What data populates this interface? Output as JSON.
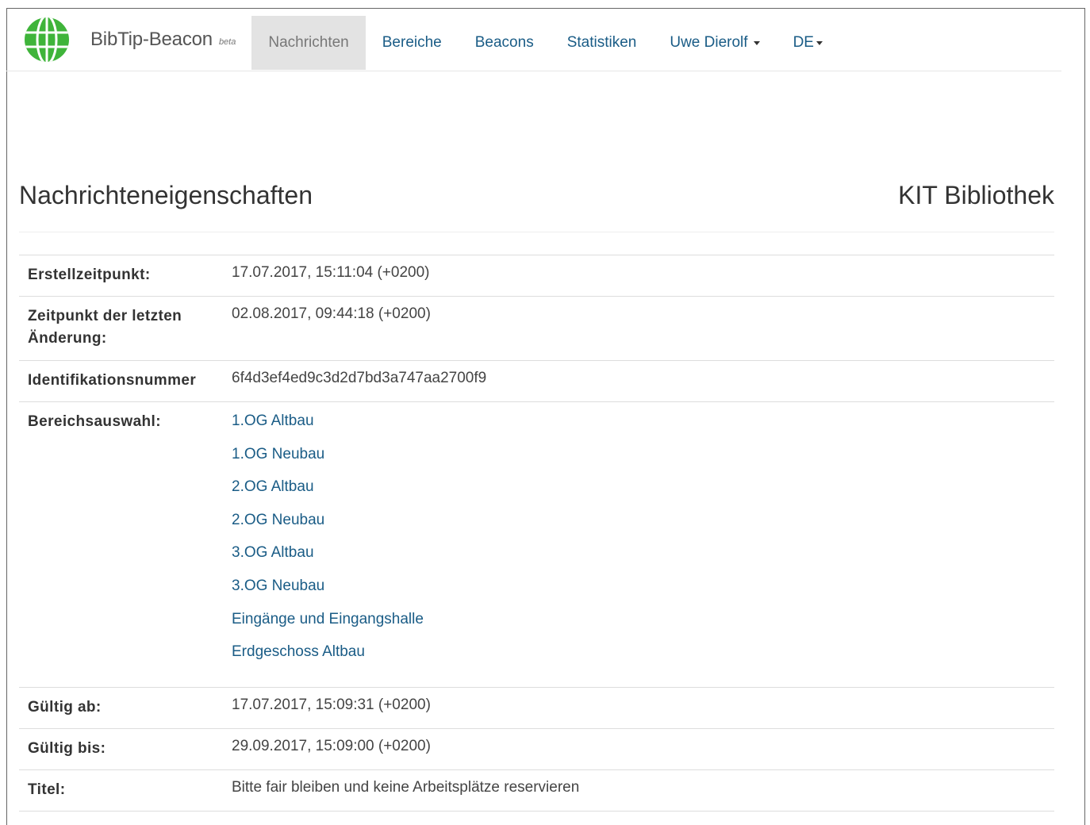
{
  "navbar": {
    "brand_name": "BibTip-Beacon",
    "brand_tag": "beta",
    "items": [
      {
        "label": "Nachrichten",
        "active": true
      },
      {
        "label": "Bereiche"
      },
      {
        "label": "Beacons"
      },
      {
        "label": "Statistiken"
      },
      {
        "label": "Uwe Dierolf",
        "dropdown": true
      },
      {
        "label": "DE",
        "dropdown": true
      }
    ],
    "logo_icon": "green-globe-icon",
    "colors": {
      "link": "#1a5c86",
      "active_bg": "#e3e3e3",
      "logo": "#3fb43a"
    }
  },
  "header": {
    "title": "Nachrichteneigenschaften",
    "library": "KIT Bibliothek"
  },
  "details": {
    "created_label": "Erstellzeitpunkt:",
    "created_value": "17.07.2017, 15:11:04 (+0200)",
    "modified_label_line1": "Zeitpunkt der letzten",
    "modified_label_line2": "Änderung:",
    "modified_value": "02.08.2017, 09:44:18 (+0200)",
    "id_label": "Identifikationsnummer",
    "id_value": "6f4d3ef4ed9c3d2d7bd3a747aa2700f9",
    "areas_label": "Bereichsauswahl:",
    "areas": [
      "1.OG Altbau",
      "1.OG Neubau",
      "2.OG Altbau",
      "2.OG Neubau",
      "3.OG Altbau",
      "3.OG Neubau",
      "Eingänge und Eingangshalle",
      "Erdgeschoss Altbau"
    ],
    "valid_from_label": "Gültig ab:",
    "valid_from_value": "17.07.2017, 15:09:31 (+0200)",
    "valid_to_label": "Gültig bis:",
    "valid_to_value": "29.09.2017, 15:09:00 (+0200)",
    "title_label": "Titel:",
    "title_value": "Bitte fair bleiben und keine Arbeitsplätze reservieren"
  }
}
